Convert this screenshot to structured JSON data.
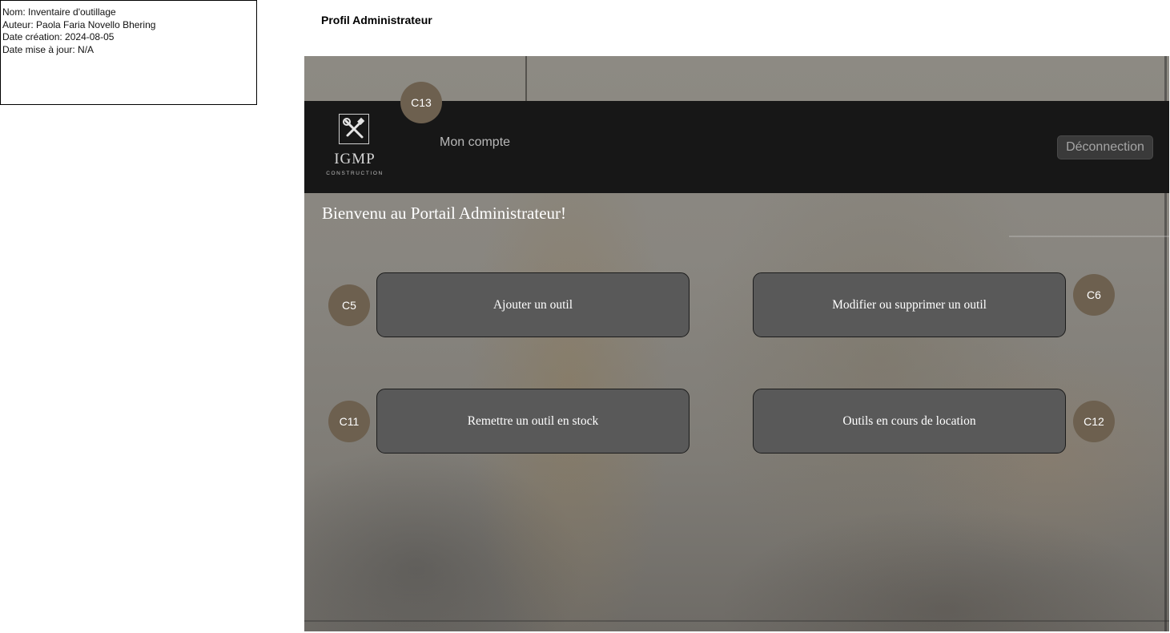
{
  "meta": {
    "lines": [
      "Nom: Inventaire d'outillage",
      "Auteur: Paola Faria Novello Bhering",
      "Date création: 2024-08-05",
      "Date mise à jour: N/A"
    ]
  },
  "page_title": "Profil Administrateur",
  "navbar": {
    "logo_text": "IGMP",
    "logo_sub": "CONSTRUCTION",
    "logo_icon": "tools-icon",
    "account_label": "Mon compte",
    "logout_label": "Déconnection"
  },
  "welcome": "Bienvenu au Portail Administrateur!",
  "actions": [
    {
      "label": "Ajouter un outil"
    },
    {
      "label": "Modifier ou supprimer un outil"
    },
    {
      "label": "Remettre un outil en stock"
    },
    {
      "label": "Outils en cours de location"
    }
  ],
  "badges": {
    "c13": "C13",
    "c5": "C5",
    "c6": "C6",
    "c11": "C11",
    "c12": "C12"
  },
  "colors": {
    "navbar_bg": "#171717",
    "button_bg": "#595959",
    "badge_bg": "#6d604f",
    "logout_bg": "#3a3a3a"
  }
}
